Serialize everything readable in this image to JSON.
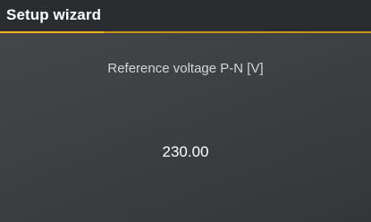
{
  "header": {
    "title": "Setup wizard"
  },
  "progress": {
    "fraction": 0.28,
    "track_color": "#c99516",
    "fill_color": "#f0b21c"
  },
  "parameter": {
    "label": "Reference voltage P-N [V]",
    "value": "230.00"
  }
}
